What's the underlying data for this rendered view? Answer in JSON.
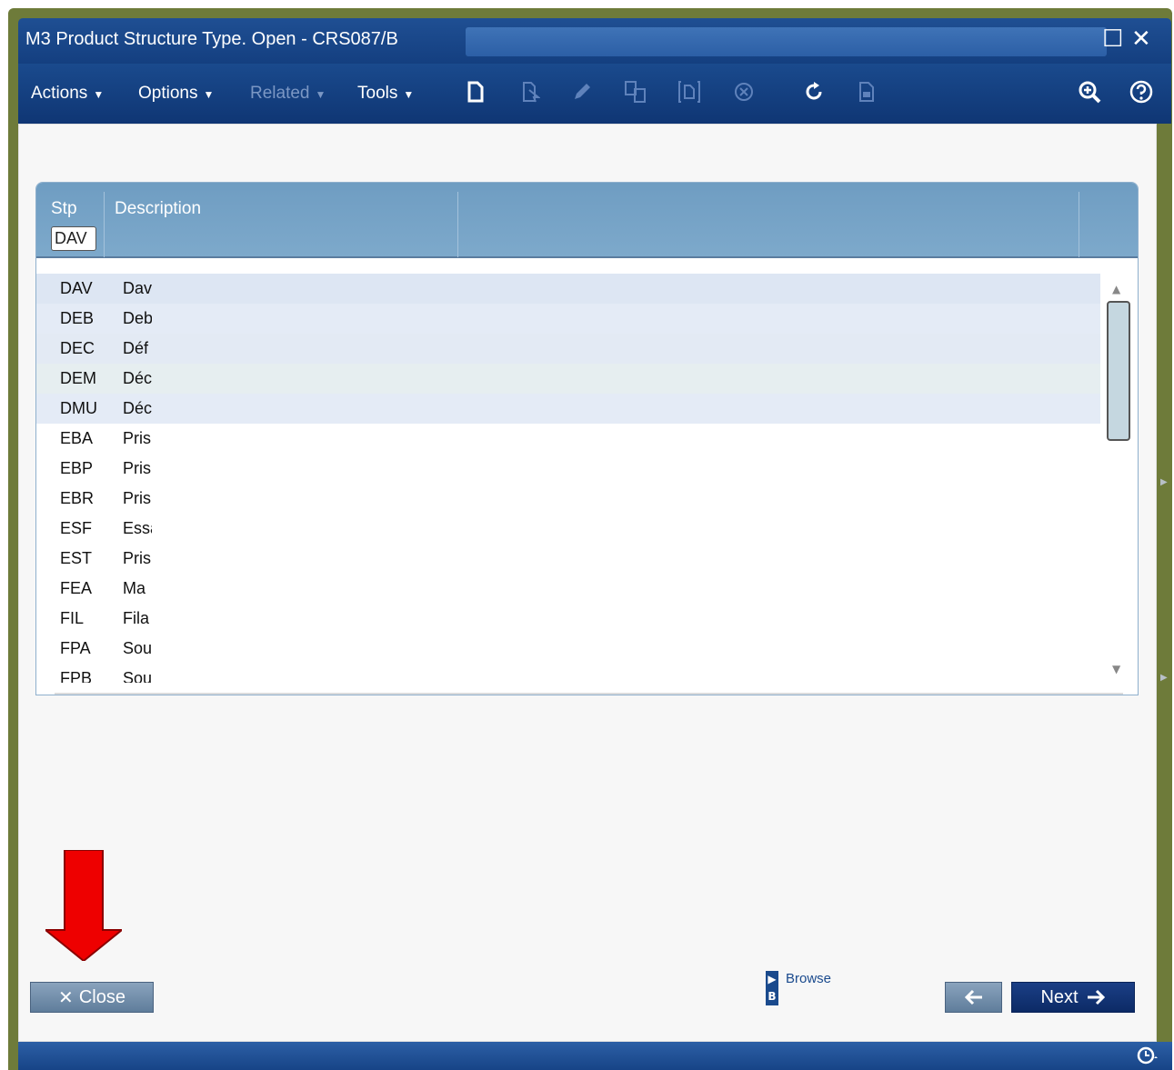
{
  "window": {
    "title": "M3 Product Structure Type. Open - CRS087/B",
    "maximize_glyph": "☐",
    "close_glyph": "✕"
  },
  "menubar": {
    "actions": "Actions",
    "options": "Options",
    "related": "Related",
    "tools": "Tools",
    "caret": "▼"
  },
  "toolbar_icons": [
    "new-icon",
    "open-icon",
    "edit-icon",
    "copy-icon",
    "display-icon",
    "delete-icon",
    "refresh-icon",
    "print-icon",
    "zoom-icon",
    "help-icon"
  ],
  "grid": {
    "columns": {
      "stp": "Stp",
      "description": "Description"
    },
    "filter_stp": "DAV",
    "rows": [
      {
        "stp": "DAV",
        "desc": "Dav"
      },
      {
        "stp": "DEB",
        "desc": "Deb"
      },
      {
        "stp": "DEC",
        "desc": "Déf"
      },
      {
        "stp": "DEM",
        "desc": "Déc"
      },
      {
        "stp": "DMU",
        "desc": "Déc"
      },
      {
        "stp": "EBA",
        "desc": "Pris"
      },
      {
        "stp": "EBP",
        "desc": "Pris"
      },
      {
        "stp": "EBR",
        "desc": "Pris"
      },
      {
        "stp": "ESF",
        "desc": "Essa"
      },
      {
        "stp": "EST",
        "desc": "Pris"
      },
      {
        "stp": "FEA",
        "desc": "Ma"
      },
      {
        "stp": "FIL",
        "desc": "Fila"
      },
      {
        "stp": "FPA",
        "desc": "Sou"
      },
      {
        "stp": "FPB",
        "desc": "Sou"
      }
    ]
  },
  "footer": {
    "close_label": "Close",
    "close_glyph": "✕",
    "browse_label": "Browse",
    "browse_key": "B",
    "next_label": "Next",
    "next_glyph": "➔",
    "prev_glyph": "🡐"
  },
  "colors": {
    "title_bar": "#1f4f93",
    "menu_bar": "#1a4a8d",
    "grid_header": "#6f9dc2",
    "next_button": "#0c2a66",
    "close_button": "#5f7d9b",
    "annotation_arrow": "#ee0000"
  }
}
